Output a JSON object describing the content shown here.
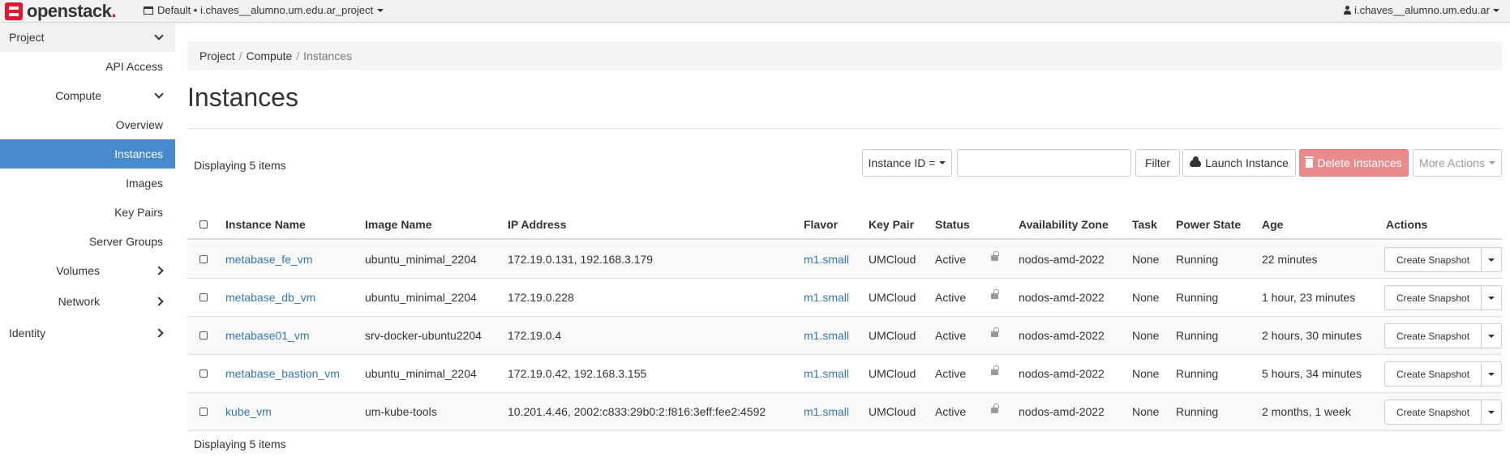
{
  "brand": {
    "name": "openstack",
    "dot": "."
  },
  "topbar": {
    "project_selector": "Default • i.chaves__alumno.um.edu.ar_project",
    "user": "i.chaves__alumno.um.edu.ar"
  },
  "sidebar": {
    "project": "Project",
    "api_access": "API Access",
    "compute": "Compute",
    "overview": "Overview",
    "instances": "Instances",
    "images": "Images",
    "key_pairs": "Key Pairs",
    "server_groups": "Server Groups",
    "volumes": "Volumes",
    "network": "Network",
    "identity": "Identity"
  },
  "breadcrumb": {
    "items": [
      "Project",
      "Compute",
      "Instances"
    ],
    "sep": "/"
  },
  "page_title": "Instances",
  "actions": {
    "filter_field": "Instance ID =",
    "filter_input_value": "",
    "filter": "Filter",
    "launch": "Launch Instance",
    "delete": "Delete Instances",
    "more": "More Actions"
  },
  "displaying": "Displaying 5 items",
  "table": {
    "headers": {
      "name": "Instance Name",
      "image": "Image Name",
      "ip": "IP Address",
      "flavor": "Flavor",
      "key_pair": "Key Pair",
      "status": "Status",
      "az": "Availability Zone",
      "task": "Task",
      "power": "Power State",
      "age": "Age",
      "actions": "Actions"
    },
    "rows": [
      {
        "name": "metabase_fe_vm",
        "image": "ubuntu_minimal_2204",
        "ip": "172.19.0.131, 192.168.3.179",
        "flavor": "m1.small",
        "key_pair": "UMCloud",
        "status": "Active",
        "az": "nodos-amd-2022",
        "task": "None",
        "power": "Running",
        "age": "22 minutes",
        "action": "Create Snapshot"
      },
      {
        "name": "metabase_db_vm",
        "image": "ubuntu_minimal_2204",
        "ip": "172.19.0.228",
        "flavor": "m1.small",
        "key_pair": "UMCloud",
        "status": "Active",
        "az": "nodos-amd-2022",
        "task": "None",
        "power": "Running",
        "age": "1 hour, 23 minutes",
        "action": "Create Snapshot"
      },
      {
        "name": "metabase01_vm",
        "image": "srv-docker-ubuntu2204",
        "ip": "172.19.0.4",
        "flavor": "m1.small",
        "key_pair": "UMCloud",
        "status": "Active",
        "az": "nodos-amd-2022",
        "task": "None",
        "power": "Running",
        "age": "2 hours, 30 minutes",
        "action": "Create Snapshot"
      },
      {
        "name": "metabase_bastion_vm",
        "image": "ubuntu_minimal_2204",
        "ip": "172.19.0.42, 192.168.3.155",
        "flavor": "m1.small",
        "key_pair": "UMCloud",
        "status": "Active",
        "az": "nodos-amd-2022",
        "task": "None",
        "power": "Running",
        "age": "5 hours, 34 minutes",
        "action": "Create Snapshot"
      },
      {
        "name": "kube_vm",
        "image": "um-kube-tools",
        "ip": "10.201.4.46, 2002:c833:29b0:2:f816:3eff:fee2:4592",
        "flavor": "m1.small",
        "key_pair": "UMCloud",
        "status": "Active",
        "az": "nodos-amd-2022",
        "task": "None",
        "power": "Running",
        "age": "2 months, 1 week",
        "action": "Create Snapshot"
      }
    ]
  },
  "colors": {
    "link": "#3278b3",
    "active_nav": "#4689cd",
    "danger": "#e98b8b",
    "brand_red": "#da1a32"
  }
}
